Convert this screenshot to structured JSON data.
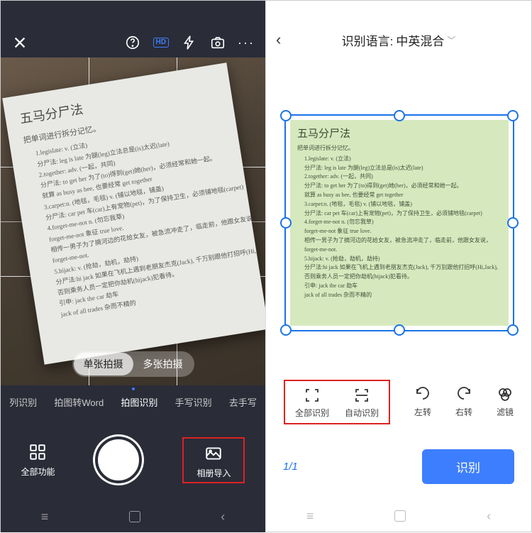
{
  "left": {
    "shot_modes": {
      "single": "单张拍摄",
      "multi": "多张拍摄"
    },
    "tabs": [
      "列识别",
      "拍图转Word",
      "拍图识别",
      "手写识别",
      "去手写"
    ],
    "bottom": {
      "all": "全部功能",
      "import": "相册导入"
    }
  },
  "doc": {
    "title": "五马分尸法",
    "subtitle": "把单词进行拆分记忆。",
    "lines": [
      "1.legislate: v. (立法)",
      "分尸法: leg is late 为腿(leg)立法总是(is)太迟(late)",
      "2.together: adv. (一起，共同)",
      "分尸法: to get her 为了(to)得到(get)她(her)，必须经常和她一起。",
      "就算 as busy as bee, 也要经常 get together",
      "3.carpet:n. (地毯，毛毯) v. (铺以地毯，铺盖)",
      "分尸法: car pet 车(car)上有宠物(pet)，为了保持卫生，必须铺地毯(carpet)",
      "4.forget-me-not n. (勿忘我草)",
      "forget-me-not 象征 true love.",
      "相传一男子为了摘河边的花给女友，被急流冲走了，临走前，他跟女友说，",
      "forget-me-not.",
      "5.hijack: v. (抢劫，劫机，劫持)",
      "分尸法:hi jack 如果在飞机上遇到老朋友杰克(Jack), 千万别跟他打招呼(Hi,Jack),",
      "否则乘务人员一定把你劫机(hijack)犯看待。",
      "引申: jack the car 劫车",
      "jack of all trades 杂而不精的"
    ]
  },
  "right": {
    "header_prefix": "识别语言:",
    "header_value": "中英混合",
    "tools": {
      "full": "全部识别",
      "auto": "自动识别",
      "left": "左转",
      "right": "右转",
      "filter": "滤镜"
    },
    "page": "1/1",
    "action": "识别"
  },
  "chart_data": null
}
